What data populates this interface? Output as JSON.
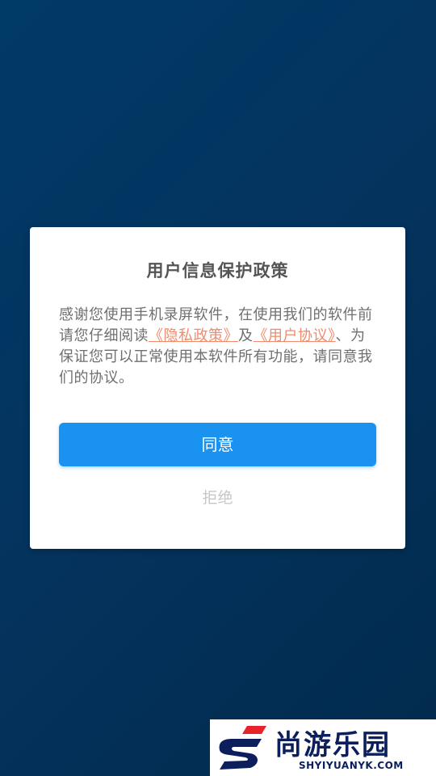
{
  "dialog": {
    "title": "用户信息保护政策",
    "text_part1": "感谢您使用手机录屏软件，在使用我们的软件前请您仔细阅读",
    "privacy_link": "《隐私政策》",
    "text_and": "及",
    "user_agreement_link": "《用户协议》",
    "text_part2": "、为保证您可以正常使用本软件所有功能，请同意我们的协议。",
    "agree_label": "同意",
    "reject_label": "拒绝"
  },
  "watermark": {
    "title": "尚游乐园",
    "url": "SHYIYUANYK.COM"
  },
  "colors": {
    "background": "#04345f",
    "agree_button": "#1a93f0",
    "link": "#f28a6c",
    "watermark_red": "#e8242a",
    "watermark_navy": "#0c1f5c"
  }
}
